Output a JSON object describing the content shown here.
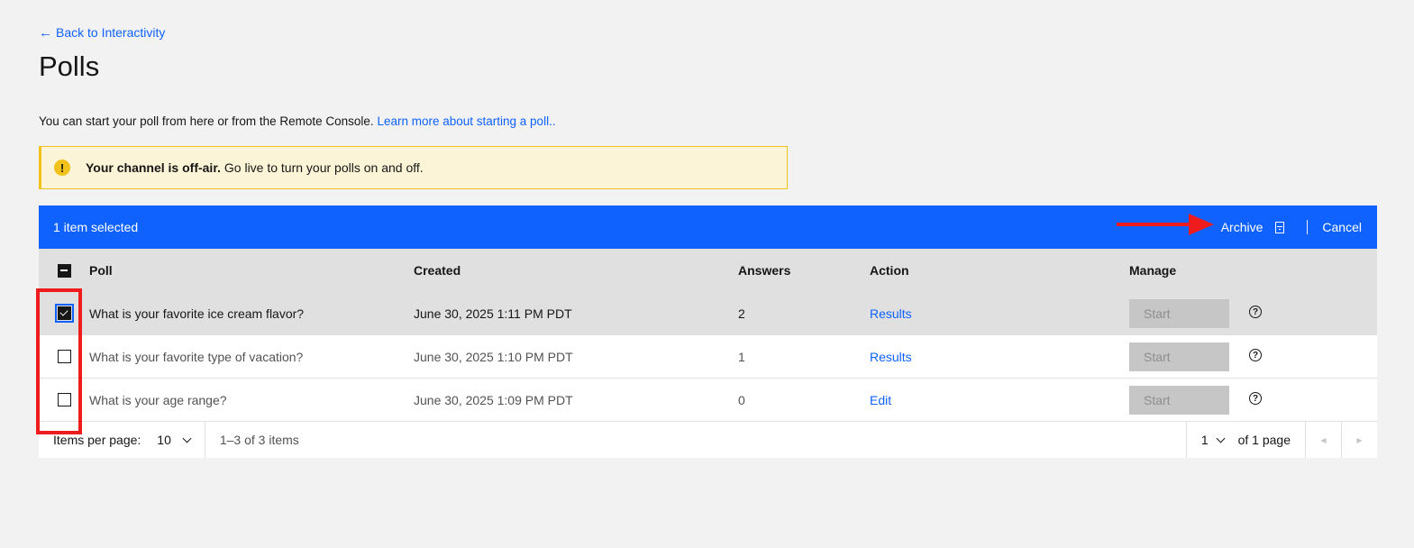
{
  "nav": {
    "back_label": "Back to Interactivity"
  },
  "page": {
    "title": "Polls",
    "intro_text": "You can start your poll from here or from the Remote Console.",
    "intro_link": "Learn more about starting a poll.."
  },
  "notification": {
    "title": "Your channel is off-air.",
    "message": "Go live to turn your polls on and off.",
    "icon": "warning-icon",
    "color": "#f1c21b"
  },
  "batch_bar": {
    "selected_text": "1 item selected",
    "archive_label": "Archive",
    "cancel_label": "Cancel",
    "color": "#0f62fe"
  },
  "table": {
    "headers": {
      "poll": "Poll",
      "created": "Created",
      "answers": "Answers",
      "action": "Action",
      "manage": "Manage"
    },
    "rows": [
      {
        "poll": "What is your favorite ice cream flavor?",
        "created": "June 30, 2025 1:11 PM PDT",
        "answers": "2",
        "action": "Results",
        "manage": "Start",
        "selected": true
      },
      {
        "poll": "What is your favorite type of vacation?",
        "created": "June 30, 2025 1:10 PM PDT",
        "answers": "1",
        "action": "Results",
        "manage": "Start",
        "selected": false
      },
      {
        "poll": "What is your age range?",
        "created": "June 30, 2025 1:09 PM PDT",
        "answers": "0",
        "action": "Edit",
        "manage": "Start",
        "selected": false
      }
    ]
  },
  "pagination": {
    "items_per_page_label": "Items per page:",
    "items_per_page_value": "10",
    "range_text": "1–3 of 3 items",
    "page_value": "1",
    "of_pages_text": "of 1 page"
  },
  "annotation": {
    "highlight_color": "#ee1c1c"
  }
}
